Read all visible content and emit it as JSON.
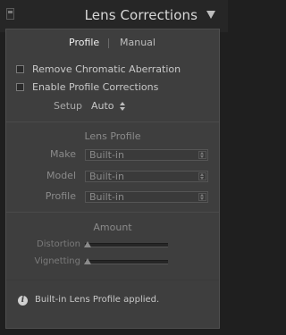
{
  "header": {
    "title": "Lens Corrections"
  },
  "tabs": [
    {
      "label": "Profile",
      "active": true
    },
    {
      "label": "Manual",
      "active": false
    }
  ],
  "checkboxes": [
    {
      "label": "Remove Chromatic Aberration",
      "checked": false
    },
    {
      "label": "Enable Profile Corrections",
      "checked": false
    }
  ],
  "setup": {
    "label": "Setup",
    "value": "Auto"
  },
  "lens_profile": {
    "title": "Lens Profile",
    "make": {
      "label": "Make",
      "value": "Built-in"
    },
    "model": {
      "label": "Model",
      "value": "Built-in"
    },
    "profile": {
      "label": "Profile",
      "value": "Built-in"
    }
  },
  "amount": {
    "title": "Amount",
    "distortion": {
      "label": "Distortion",
      "level": 0
    },
    "vignetting": {
      "label": "Vignetting",
      "level": 0
    }
  },
  "status": {
    "icon": "info-icon",
    "text": "Built-in Lens Profile applied."
  },
  "colors": {
    "panel_bg": "#3e3e3e",
    "header_bg": "#262626",
    "page_bg": "#1f1f1f"
  }
}
